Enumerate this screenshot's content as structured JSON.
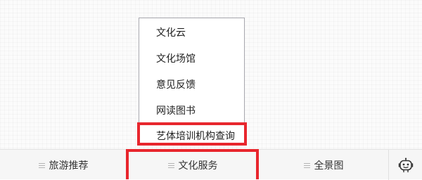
{
  "menu": {
    "items": [
      {
        "label": "文化云"
      },
      {
        "label": "文化场馆"
      },
      {
        "label": "意见反馈"
      },
      {
        "label": "网读图书"
      },
      {
        "label": "艺体培训机构查询"
      }
    ]
  },
  "bottom_nav": {
    "tabs": [
      {
        "label": "旅游推荐",
        "icon": "menu-lines-icon"
      },
      {
        "label": "文化服务",
        "icon": "menu-lines-icon"
      },
      {
        "label": "全景图",
        "icon": "menu-lines-icon"
      }
    ],
    "assistant_icon": "robot-icon"
  },
  "colors": {
    "highlight": "#e8262d",
    "bar_bg": "#f6f6f6",
    "menu_border": "#a9a9b0"
  }
}
